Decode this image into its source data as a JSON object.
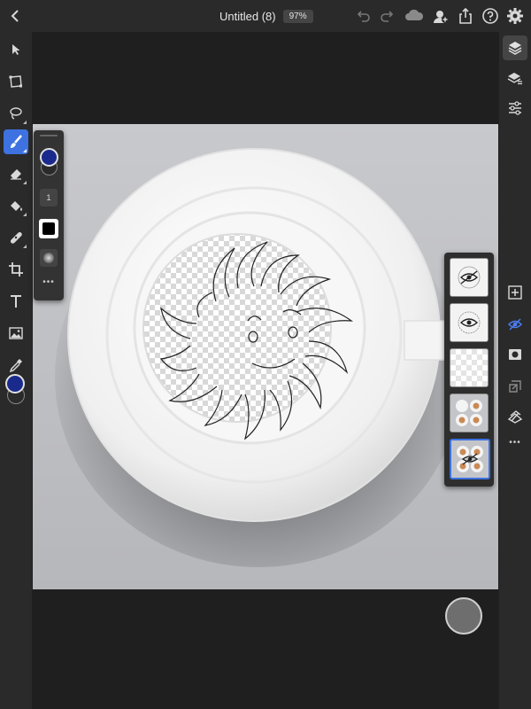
{
  "header": {
    "title": "Untitled (8)",
    "zoom": "97%"
  },
  "toolbar_left": {
    "tools": [
      "select-icon",
      "transform-icon",
      "lasso-icon",
      "brush-icon",
      "eraser-icon",
      "fill-icon",
      "healing-icon",
      "crop-icon",
      "text-icon",
      "image-icon",
      "eyedropper-icon"
    ],
    "active_tool": "brush-icon",
    "primary_color": "#1a2a8c",
    "secondary_color": "#2a2a2a"
  },
  "brush_panel": {
    "size": "1",
    "more_label": "•••"
  },
  "toolbar_right": {
    "tools": [
      "layers-icon",
      "layer-properties-icon",
      "adjustments-icon",
      "add-layer-icon",
      "visibility-icon",
      "mask-icon",
      "merge-down-icon",
      "clear-layer-icon",
      "more-icon"
    ],
    "more_label": "•••"
  },
  "layers": [
    {
      "name": "layer-1",
      "visibility": "hidden"
    },
    {
      "name": "layer-2",
      "visibility": "visible"
    },
    {
      "name": "layer-3",
      "visibility": "visible"
    },
    {
      "name": "layer-4",
      "visibility": "visible"
    },
    {
      "name": "layer-5",
      "visibility": "hidden",
      "selected": true
    }
  ],
  "colors": {
    "accent": "#3d72e0",
    "background": "#1f1f1f",
    "panel": "#2a2a2a"
  }
}
